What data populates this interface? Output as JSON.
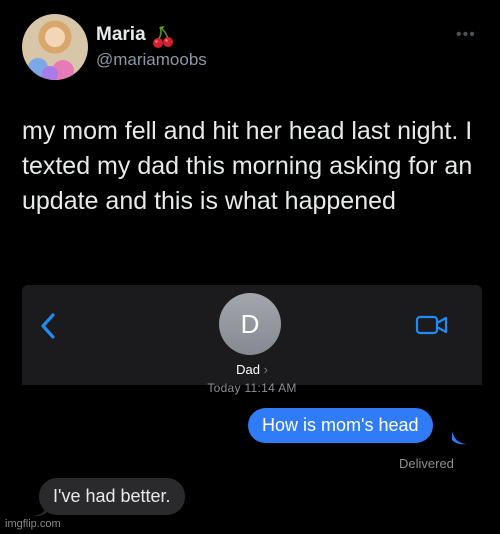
{
  "tweet": {
    "author_name": "Maria",
    "author_emoji": "cherries",
    "handle": "@mariamoobs",
    "more_icon": "more-icon",
    "text": "my mom fell and hit her head last night. I texted my dad this morning asking for an update and this is what happened"
  },
  "conversation": {
    "contact_initial": "D",
    "contact_name": "Dad",
    "contact_chevron": "›",
    "timestamp": "Today 11:14 AM",
    "messages": [
      {
        "direction": "sent",
        "text": "How is mom's head"
      },
      {
        "direction": "received",
        "text": "I've had better."
      }
    ],
    "status": "Delivered"
  },
  "colors": {
    "background": "#000000",
    "sent_bubble": "#2f7cf6",
    "received_bubble": "#2a2a2c",
    "ios_accent": "#1f8bf5"
  },
  "watermark": "imgflip.com"
}
